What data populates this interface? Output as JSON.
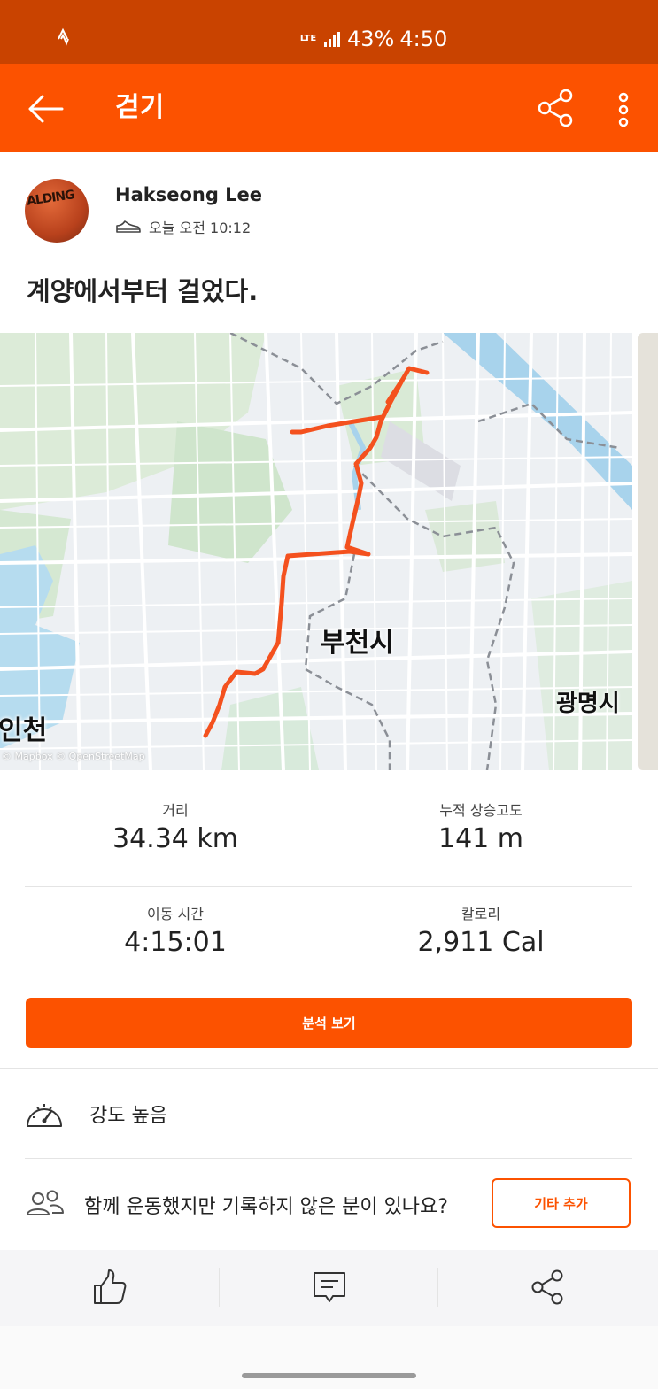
{
  "status_bar": {
    "network": "LTE",
    "battery": "43%",
    "time": "4:50"
  },
  "app_bar": {
    "title": "걷기"
  },
  "activity": {
    "athlete_name": "Hakseong Lee",
    "timestamp": "오늘 오전 10:12",
    "title": "계양에서부터 걸었다.",
    "avatar_text": "ALDING"
  },
  "map": {
    "labels": {
      "bucheon": "부천시",
      "gwangmyeong": "광명시",
      "incheon": "인천"
    },
    "attribution": "© Mapbox © OpenStreetMap",
    "route_color": "#f4511e"
  },
  "stats": {
    "distance": {
      "label": "거리",
      "value": "34.34 km"
    },
    "elevation": {
      "label": "누적 상승고도",
      "value": "141 m"
    },
    "moving_time": {
      "label": "이동 시간",
      "value": "4:15:01"
    },
    "calories": {
      "label": "칼로리",
      "value": "2,911 Cal"
    }
  },
  "analysis_button": "분석 보기",
  "intensity": "강도 높음",
  "add_others": {
    "prompt": "함께 운동했지만 기록하지 않은 분이 있나요?",
    "button": "기타 추가"
  },
  "colors": {
    "brand": "#fc5200",
    "status_bar": "#c94300"
  },
  "icons": [
    "arrow-left-icon",
    "share-icon",
    "more-vertical-icon",
    "shoe-icon",
    "gauge-icon",
    "group-icon",
    "thumbs-up-icon",
    "comment-icon"
  ]
}
